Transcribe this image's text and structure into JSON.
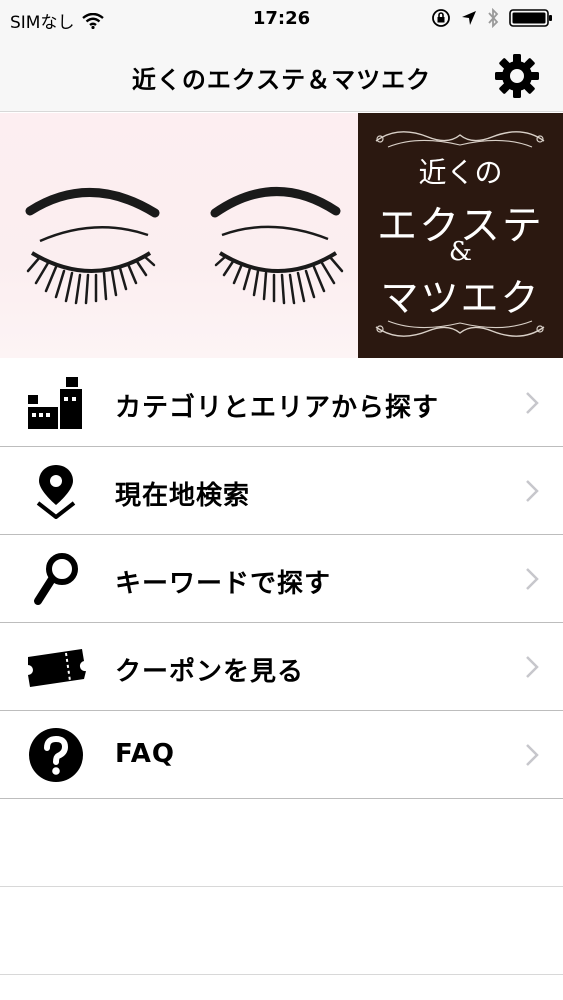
{
  "status_bar": {
    "carrier": "SIMなし",
    "time": "17:26"
  },
  "nav": {
    "title": "近くのエクステ＆マツエク"
  },
  "banner": {
    "line1": "近くの",
    "line2": "エクステ",
    "line3": "&",
    "line4": "マツエク"
  },
  "menu": {
    "items": [
      {
        "label": "カテゴリとエリアから探す",
        "icon": "category-area-icon"
      },
      {
        "label": "現在地検索",
        "icon": "location-pin-icon"
      },
      {
        "label": "キーワードで探す",
        "icon": "magnifier-icon"
      },
      {
        "label": "クーポンを見る",
        "icon": "ticket-icon"
      },
      {
        "label": "FAQ",
        "icon": "question-icon"
      }
    ]
  },
  "colors": {
    "banner_dark": "#2b1810",
    "banner_pink": "#fdeef1",
    "chevron": "#c7c7cc"
  }
}
